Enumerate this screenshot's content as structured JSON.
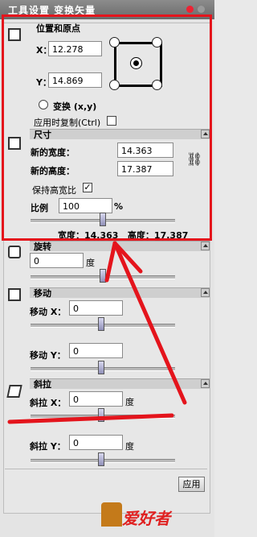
{
  "window": {
    "title": "工具设置 变换矢量"
  },
  "position": {
    "section_title": "位置和原点",
    "x_label": "X：",
    "x_value": "12.278",
    "y_label": "Y：",
    "y_value": "14.869",
    "transform_label": "变换 (x,y)",
    "copy_on_apply_label": "应用时复制(Ctrl)"
  },
  "size": {
    "section_title": "尺寸",
    "width_label": "新的宽度：",
    "width_value": "14.363",
    "height_label": "新的高度：",
    "height_value": "17.387",
    "keep_ratio_label": "保持高宽比",
    "keep_ratio_check": "✓",
    "scale_label": "比例",
    "scale_value": "100",
    "percent": "%",
    "scale_slider_fraction": 0.5,
    "readout": "宽度：14.363   高度：17.387"
  },
  "rotate": {
    "section_title": "旋转",
    "value": "0",
    "unit": "度",
    "slider_fraction": 0.5
  },
  "move": {
    "section_title": "移动",
    "x_label": "移动 X：",
    "x_value": "0",
    "y_label": "移动 Y：",
    "y_value": "0"
  },
  "skew": {
    "section_title": "斜拉",
    "x_label": "斜拉 X：",
    "x_value": "0",
    "x_unit": "度",
    "y_label": "斜拉 Y：",
    "y_value": "0",
    "y_unit": "度"
  },
  "apply_button": "应用",
  "watermark": "爱好者",
  "colors": {
    "annotation_red": "#e4141c"
  }
}
